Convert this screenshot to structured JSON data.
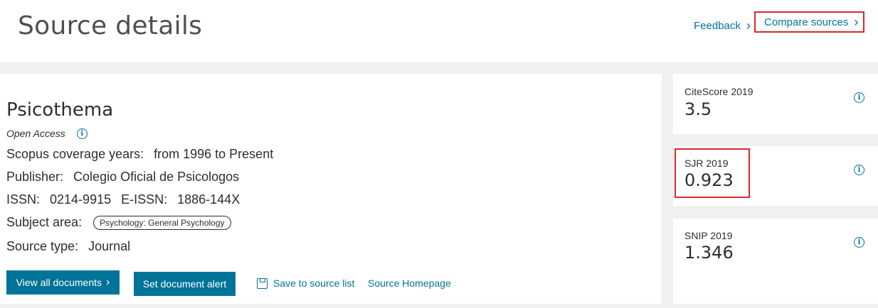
{
  "page": {
    "title": "Source details"
  },
  "header": {
    "feedback_label": "Feedback",
    "compare_label": "Compare sources"
  },
  "source": {
    "title": "Psicothema",
    "open_access": "Open Access",
    "coverage_label": "Scopus coverage years:",
    "coverage_value": "from 1996 to Present",
    "publisher_label": "Publisher:",
    "publisher_value": "Colegio Oficial de Psicologos",
    "issn_label": "ISSN:",
    "issn_value": "0214-9915",
    "eissn_label": "E-ISSN:",
    "eissn_value": "1886-144X",
    "subject_label": "Subject area:",
    "subject_value": "Psychology: General Psychology",
    "type_label": "Source type:",
    "type_value": "Journal"
  },
  "actions": {
    "view_all": "View all documents",
    "set_alert": "Set document alert",
    "save": "Save to source list",
    "homepage": "Source Homepage"
  },
  "metrics": {
    "citescore_label": "CiteScore 2019",
    "citescore_value": "3.5",
    "sjr_label": "SJR 2019",
    "sjr_value": "0.923",
    "snip_label": "SNIP 2019",
    "snip_value": "1.346"
  },
  "icons": {
    "info": "info-icon",
    "chevron": "chevron-right-icon",
    "save": "save-icon"
  },
  "colors": {
    "link": "#007398",
    "button": "#007398",
    "highlight": "#d9282a",
    "background": "#f0f0f0"
  }
}
